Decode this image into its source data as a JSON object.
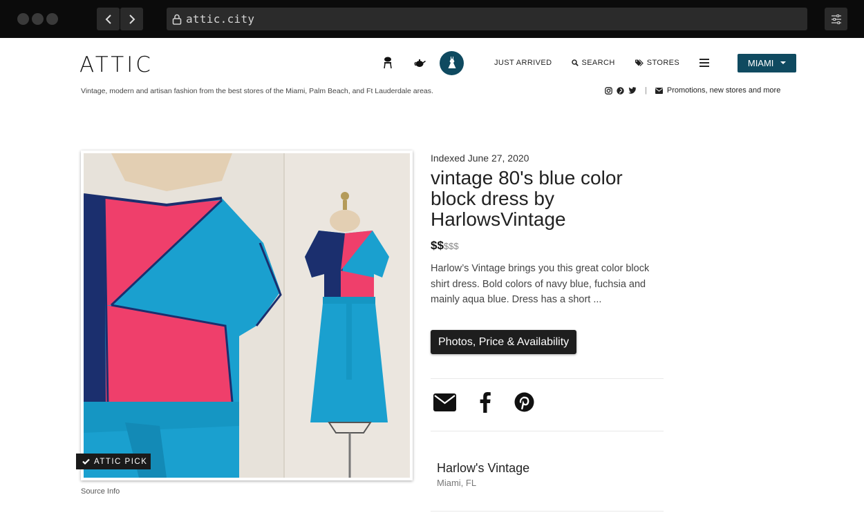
{
  "browser": {
    "url": "attic.city"
  },
  "header": {
    "logo": "ATTIC",
    "nav": {
      "just_arrived": "JUST ARRIVED",
      "search": "SEARCH",
      "stores": "STORES",
      "city": "MIAMI"
    },
    "category_icons": [
      "furniture-icon",
      "teapot-icon",
      "dress-icon"
    ],
    "tagline": "Vintage, modern and artisan fashion from the best stores of the Miami, Palm Beach, and Ft Lauderdale areas.",
    "promo_link": "Promotions, new stores and more"
  },
  "product": {
    "badge": "ATTIC PICK",
    "source_label": "Source Info",
    "indexed": "Indexed June 27, 2020",
    "title": "vintage 80's blue color block dress by HarlowsVintage",
    "price_active": "$$",
    "price_inactive": "$$$",
    "description": "Harlow’s Vintage brings you this great color block shirt dress. Bold colors of navy blue, fuchsia and mainly aqua blue. Dress has a short ...",
    "cta_label": "Photos, Price & Availability"
  },
  "store": {
    "name": "Harlow's Vintage",
    "location": "Miami, FL"
  },
  "colors": {
    "accent": "#0f4a60",
    "aqua": "#1aa0cf",
    "fuchsia": "#ef3f6b",
    "navy": "#1b2f6e"
  }
}
